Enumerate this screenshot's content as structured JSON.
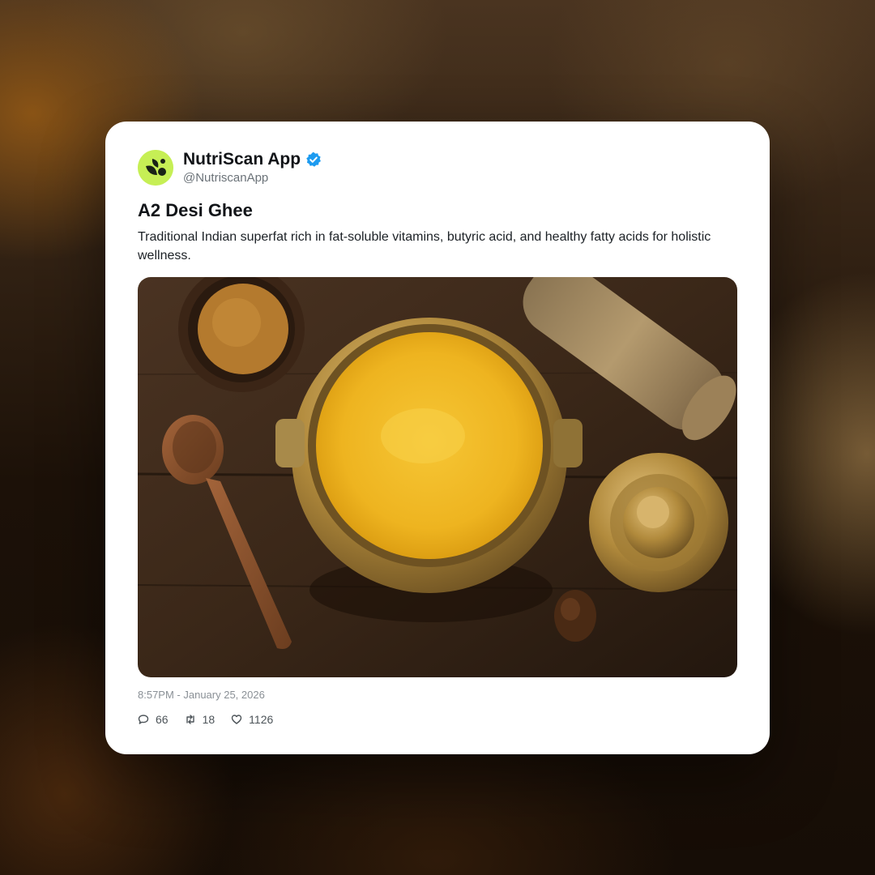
{
  "post": {
    "author": {
      "display_name": "NutriScan App",
      "handle": "@NutriscanApp",
      "verified": true,
      "avatar_icon": "leaf-logo-icon",
      "avatar_color": "#c6ef55"
    },
    "title": "A2 Desi Ghee",
    "description": "Traditional Indian superfat rich in fat-soluble vitamins, butyric acid, and healthy fatty acids for holistic wellness.",
    "image_icon": "ghee-pot-photo",
    "timestamp": "8:57PM - January 25, 2026",
    "stats": {
      "replies": "66",
      "retweets": "18",
      "likes": "1126"
    }
  },
  "colors": {
    "verified_badge": "#1d9bf0",
    "card_background": "#ffffff",
    "ghee": "#f0b41c",
    "brass": "#b8923e"
  }
}
